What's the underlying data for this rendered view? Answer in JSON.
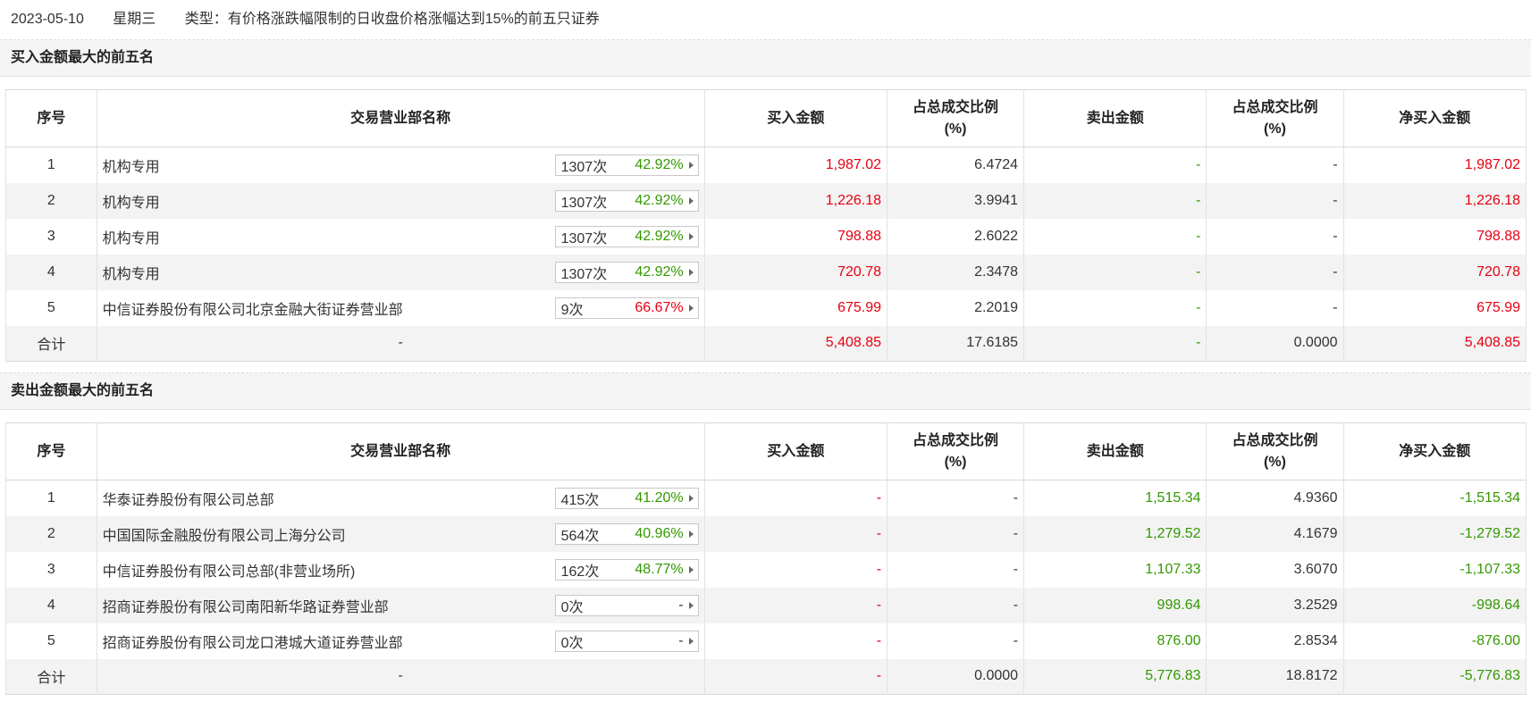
{
  "header": {
    "date": "2023-05-10",
    "weekday": "星期三",
    "type": "类型：有价格涨跌幅限制的日收盘价格涨幅达到15%的前五只证券"
  },
  "columns": [
    "序号",
    "交易营业部名称",
    "买入金额",
    "占总成交比例\n(%)",
    "卖出金额",
    "占总成交比例\n(%)",
    "净买入金额"
  ],
  "colors": {
    "up": "#e60012",
    "down": "#339900"
  },
  "buy_section": {
    "title": "买入金额最大的前五名",
    "rows": [
      {
        "no": "1",
        "name": "机构专用",
        "count": "1307次",
        "rate": "42.92%",
        "rate_color": "green",
        "buy": "1,987.02",
        "buy_pct": "6.4724",
        "sell": "-",
        "sell_pct": "-",
        "net": "1,987.02"
      },
      {
        "no": "2",
        "name": "机构专用",
        "count": "1307次",
        "rate": "42.92%",
        "rate_color": "green",
        "buy": "1,226.18",
        "buy_pct": "3.9941",
        "sell": "-",
        "sell_pct": "-",
        "net": "1,226.18"
      },
      {
        "no": "3",
        "name": "机构专用",
        "count": "1307次",
        "rate": "42.92%",
        "rate_color": "green",
        "buy": "798.88",
        "buy_pct": "2.6022",
        "sell": "-",
        "sell_pct": "-",
        "net": "798.88"
      },
      {
        "no": "4",
        "name": "机构专用",
        "count": "1307次",
        "rate": "42.92%",
        "rate_color": "green",
        "buy": "720.78",
        "buy_pct": "2.3478",
        "sell": "-",
        "sell_pct": "-",
        "net": "720.78"
      },
      {
        "no": "5",
        "name": "中信证券股份有限公司北京金融大街证券营业部",
        "count": "9次",
        "rate": "66.67%",
        "rate_color": "red",
        "buy": "675.99",
        "buy_pct": "2.2019",
        "sell": "-",
        "sell_pct": "-",
        "net": "675.99"
      }
    ],
    "total": {
      "label": "合计",
      "name": "-",
      "buy": "5,408.85",
      "buy_pct": "17.6185",
      "sell": "-",
      "sell_pct": "0.0000",
      "net": "5,408.85"
    }
  },
  "sell_section": {
    "title": "卖出金额最大的前五名",
    "rows": [
      {
        "no": "1",
        "name": "华泰证券股份有限公司总部",
        "count": "415次",
        "rate": "41.20%",
        "rate_color": "green",
        "buy": "-",
        "buy_pct": "-",
        "sell": "1,515.34",
        "sell_pct": "4.9360",
        "net": "-1,515.34"
      },
      {
        "no": "2",
        "name": "中国国际金融股份有限公司上海分公司",
        "count": "564次",
        "rate": "40.96%",
        "rate_color": "green",
        "buy": "-",
        "buy_pct": "-",
        "sell": "1,279.52",
        "sell_pct": "4.1679",
        "net": "-1,279.52"
      },
      {
        "no": "3",
        "name": "中信证券股份有限公司总部(非营业场所)",
        "count": "162次",
        "rate": "48.77%",
        "rate_color": "green",
        "buy": "-",
        "buy_pct": "-",
        "sell": "1,107.33",
        "sell_pct": "3.6070",
        "net": "-1,107.33"
      },
      {
        "no": "4",
        "name": "招商证券股份有限公司南阳新华路证券营业部",
        "count": "0次",
        "rate": "-",
        "rate_color": "dark",
        "buy": "-",
        "buy_pct": "-",
        "sell": "998.64",
        "sell_pct": "3.2529",
        "net": "-998.64"
      },
      {
        "no": "5",
        "name": "招商证券股份有限公司龙口港城大道证券营业部",
        "count": "0次",
        "rate": "-",
        "rate_color": "dark",
        "buy": "-",
        "buy_pct": "-",
        "sell": "876.00",
        "sell_pct": "2.8534",
        "net": "-876.00"
      }
    ],
    "total": {
      "label": "合计",
      "name": "-",
      "buy": "-",
      "buy_pct": "0.0000",
      "sell": "5,776.83",
      "sell_pct": "18.8172",
      "net": "-5,776.83"
    }
  }
}
